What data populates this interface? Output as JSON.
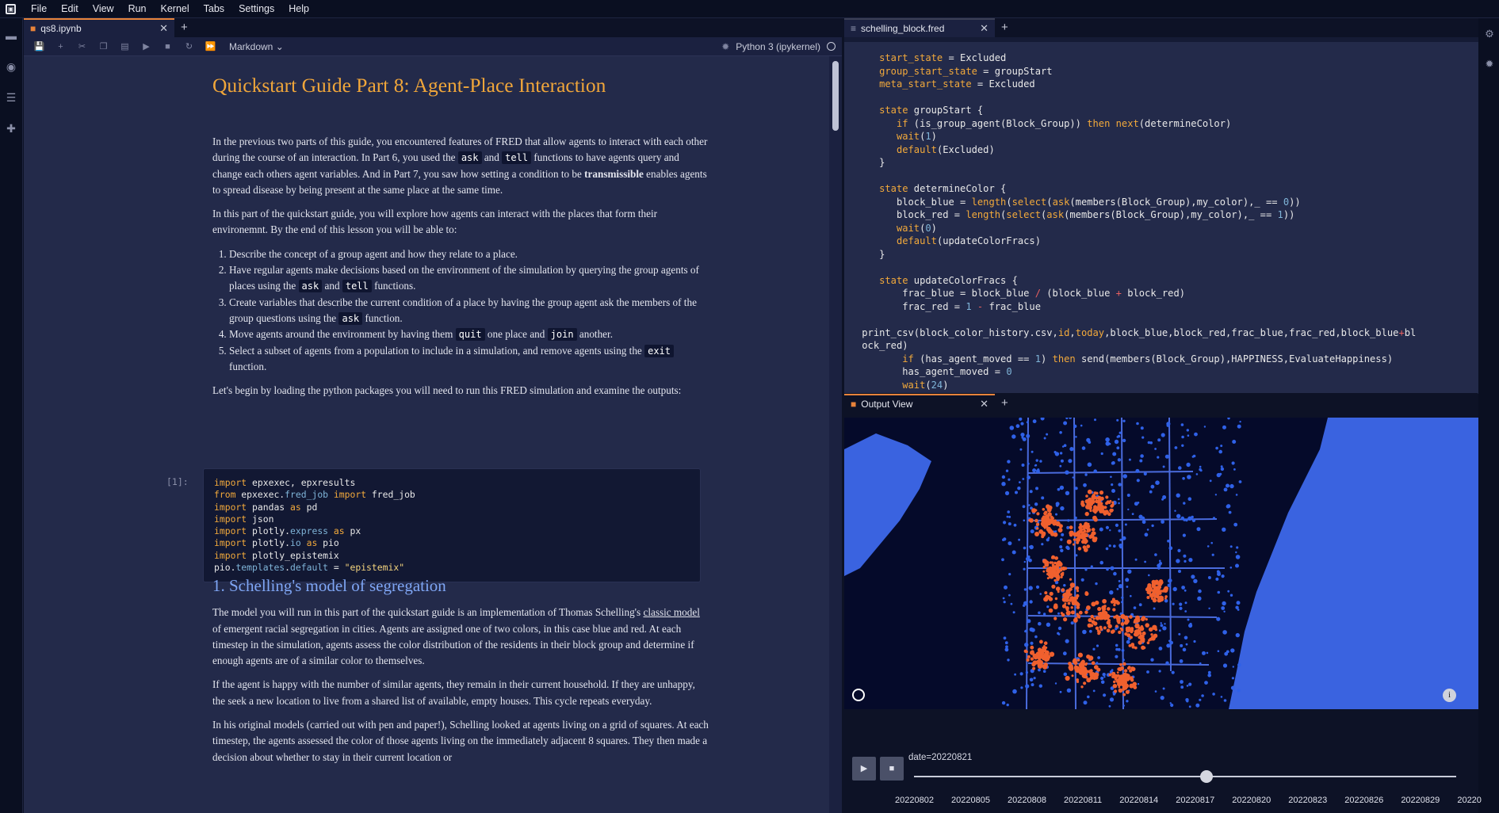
{
  "menu": [
    "File",
    "Edit",
    "View",
    "Run",
    "Kernel",
    "Tabs",
    "Settings",
    "Help"
  ],
  "notebook": {
    "tab_label": "qs8.ipynb",
    "cell_type": "Markdown",
    "kernel": "Python 3 (ipykernel)",
    "title": "Quickstart Guide Part 8: Agent-Place Interaction",
    "p1_a": "In the previous two parts of this guide, you encountered features of FRED that allow agents to interact with each other during the course of an interaction. In Part 6, you used the ",
    "p1_ask": "ask",
    "p1_and": " and ",
    "p1_tell": "tell",
    "p1_b": " functions to have agents query and change each others agent variables. And in Part 7, you saw how setting a condition to be ",
    "p1_bold": "transmissible",
    "p1_c": " enables agents to spread disease by being present at the same place at the same time.",
    "p2": "In this part of the quickstart guide, you will explore how agents can interact with the places that form their environemnt. By the end of this lesson you will be able to:",
    "li1": "Describe the concept of a group agent and how they relate to a place.",
    "li2_a": "Have regular agents make decisions based on the environment of the simulation by querying the group agents of places using the ",
    "li2_ask": "ask",
    "li2_and": " and ",
    "li2_tell": "tell",
    "li2_b": " functions.",
    "li3_a": "Create variables that describe the current condition of a place by having the group agent ask the members of the group questions using the ",
    "li3_ask": "ask",
    "li3_b": " function.",
    "li4_a": "Move agents around the environment by having them ",
    "li4_quit": "quit",
    "li4_b": " one place and ",
    "li4_join": "join",
    "li4_c": " another.",
    "li5_a": "Select a subset of agents from a population to include in a simulation, and remove agents using the ",
    "li5_exit": "exit",
    "li5_b": " function.",
    "p3": "Let's begin by loading the python packages you will need to run this FRED simulation and examine the outputs:",
    "prompt": "[1]:",
    "section": "1. Schelling's model of segregation",
    "p4_a": "The model you will run in this part of the quickstart guide is an implementation of Thomas Schelling's ",
    "p4_link": "classic model",
    "p4_b": " of emergent racial segregation in cities. Agents are assigned one of two colors, in this case blue and red. At each timestep in the simulation, agents assess the color distribution of the residents in their block group and determine if enough agents are of a similar color to themselves.",
    "p5": "If the agent is happy with the number of similar agents, they remain in their current household. If they are unhappy, the seek a new location to live from a shared list of available, empty houses. This cycle repeats everyday.",
    "p6": "In his original models (carried out with pen and paper!), Schelling looked at agents living on a grid of squares. At each timestep, the agents assessed the color of those agents living on the immediately adjacent 8 squares. They then made a decision about whether to stay in their current location or"
  },
  "editor": {
    "tab_label": "schelling_block.fred"
  },
  "output": {
    "tab_label": "Output View",
    "date_label": "date=20220821",
    "slider_fraction": 0.54,
    "ticks": [
      "20220802",
      "20220805",
      "20220808",
      "20220811",
      "20220814",
      "20220817",
      "20220820",
      "20220823",
      "20220826",
      "20220829",
      "20220⁠"
    ],
    "colors": {
      "land": "#050a2a",
      "water": "#3a63e0",
      "blue_agents": "#2f61e8",
      "red_agents": "#f0602e",
      "roads": "#4a6bdc"
    }
  },
  "icons": [
    "folder-icon",
    "running-icon",
    "toc-icon",
    "extension-icon",
    "property-inspector-icon",
    "debugger-icon"
  ]
}
